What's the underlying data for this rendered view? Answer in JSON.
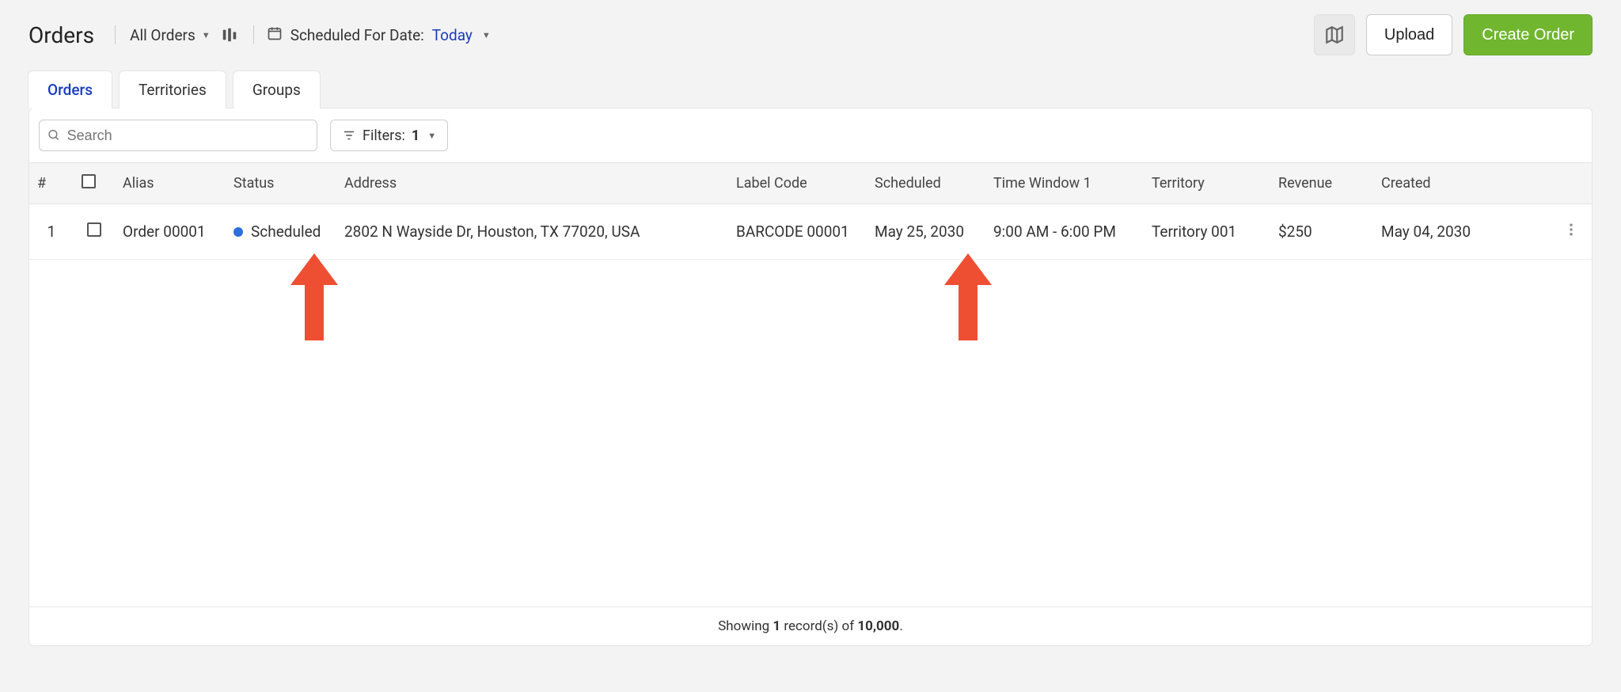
{
  "header": {
    "title": "Orders",
    "orders_dropdown_label": "All Orders",
    "scheduled_for_label": "Scheduled For Date:",
    "scheduled_for_value": "Today",
    "upload_label": "Upload",
    "create_label": "Create Order"
  },
  "tabs": {
    "orders": "Orders",
    "territories": "Territories",
    "groups": "Groups"
  },
  "filters": {
    "search_placeholder": "Search",
    "label": "Filters:",
    "count": "1"
  },
  "columns": {
    "num": "#",
    "alias": "Alias",
    "status": "Status",
    "address": "Address",
    "label_code": "Label Code",
    "scheduled": "Scheduled",
    "time_window": "Time Window 1",
    "territory": "Territory",
    "revenue": "Revenue",
    "created": "Created"
  },
  "rows": [
    {
      "num": "1",
      "alias": "Order 00001",
      "status": "Scheduled",
      "address": "2802 N Wayside Dr, Houston, TX 77020, USA",
      "label_code": "BARCODE 00001",
      "scheduled": "May 25, 2030",
      "time_window": "9:00 AM - 6:00 PM",
      "territory": "Territory 001",
      "revenue": "$250",
      "created": "May 04, 2030"
    }
  ],
  "footer": {
    "prefix": "Showing ",
    "count": "1",
    "middle": " record(s) of ",
    "total": "10,000",
    "suffix": "."
  }
}
